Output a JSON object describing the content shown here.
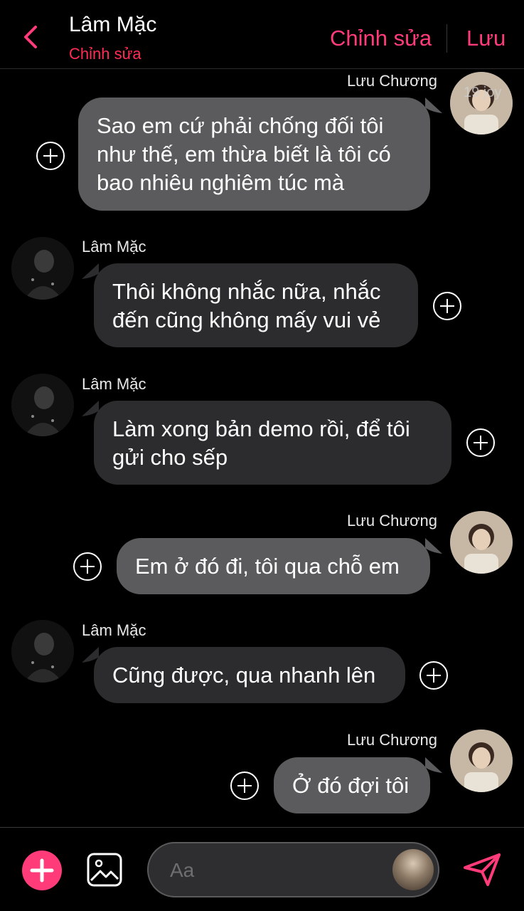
{
  "header": {
    "name": "Lâm Mặc",
    "subtitle": "Chỉnh sửa",
    "edit_label": "Chỉnh sửa",
    "save_label": "Lưu"
  },
  "watermark": "19 joy",
  "messages": [
    {
      "sender": "Lưu Chương",
      "side": "right",
      "text": "Sao em cứ phải chống đối tôi như thế, em thừa biết là tôi có bao nhiêu nghiêm túc mà"
    },
    {
      "sender": "Lâm Mặc",
      "side": "left",
      "text": "Thôi không nhắc nữa, nhắc đến cũng không mấy vui vẻ"
    },
    {
      "sender": "Lâm Mặc",
      "side": "left",
      "text": "Làm xong bản demo rồi, để tôi gửi cho sếp"
    },
    {
      "sender": "Lưu Chương",
      "side": "right",
      "text": "Em ở đó đi, tôi qua chỗ em"
    },
    {
      "sender": "Lâm Mặc",
      "side": "left",
      "text": "Cũng được, qua nhanh lên"
    },
    {
      "sender": "Lưu Chương",
      "side": "right",
      "text": "Ở đó đợi tôi"
    }
  ],
  "composer": {
    "placeholder": "Aa"
  },
  "colors": {
    "accent": "#ff3b7a",
    "left_bubble": "#2c2c2e",
    "right_bubble": "#5b5b5d",
    "background": "#000000"
  },
  "icons": [
    "back-chevron-icon",
    "add-reaction-icon",
    "plus-icon",
    "image-icon",
    "send-icon"
  ]
}
